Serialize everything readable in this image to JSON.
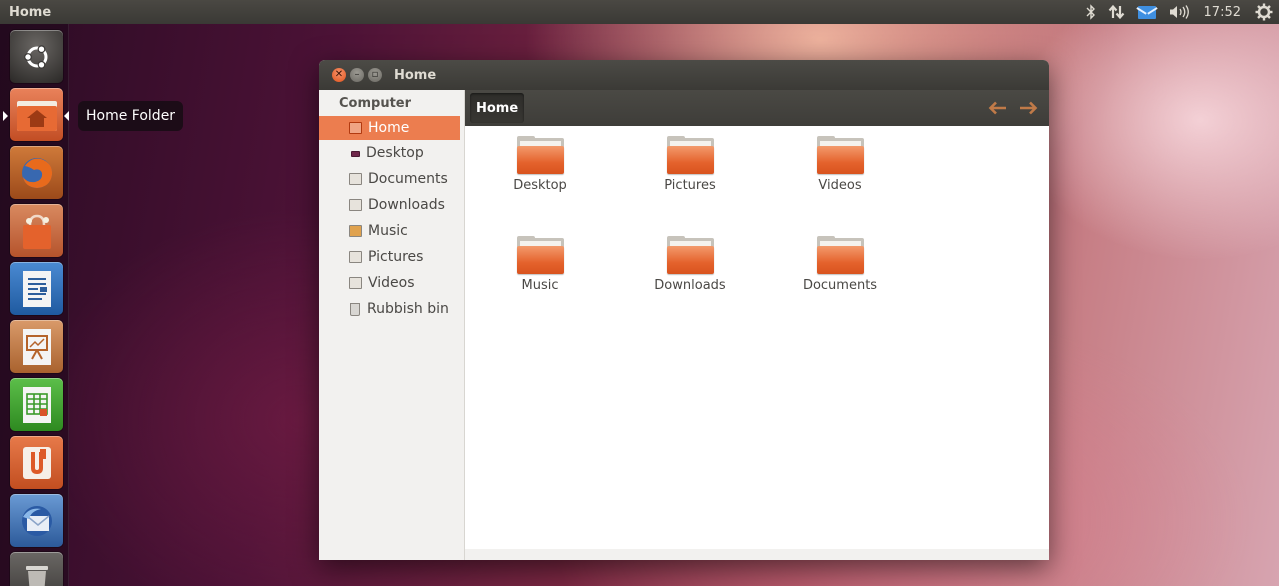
{
  "panel": {
    "app_title": "Home",
    "clock": "17:52",
    "icons": [
      "bluetooth-icon",
      "network-icon",
      "mail-icon",
      "volume-icon",
      "settings-icon"
    ]
  },
  "launcher": {
    "items": [
      {
        "name": "ubuntu-dash-icon",
        "label": "Dash"
      },
      {
        "name": "home-folder-icon",
        "label": "Home Folder"
      },
      {
        "name": "firefox-icon",
        "label": "Firefox"
      },
      {
        "name": "software-centre-icon",
        "label": "Software Centre"
      },
      {
        "name": "writer-icon",
        "label": "Writer"
      },
      {
        "name": "impress-icon",
        "label": "Impress"
      },
      {
        "name": "calc-icon",
        "label": "Calc"
      },
      {
        "name": "ubuntu-one-icon",
        "label": "Ubuntu One"
      },
      {
        "name": "thunderbird-icon",
        "label": "Thunderbird"
      },
      {
        "name": "trash-icon",
        "label": "Trash"
      }
    ],
    "tooltip": "Home Folder"
  },
  "window": {
    "title": "Home",
    "sidebar": {
      "header": "Computer",
      "items": [
        {
          "label": "Home",
          "icon": "home-icon",
          "active": true
        },
        {
          "label": "Desktop",
          "icon": "desktop-icon"
        },
        {
          "label": "Documents",
          "icon": "documents-icon"
        },
        {
          "label": "Downloads",
          "icon": "downloads-icon"
        },
        {
          "label": "Music",
          "icon": "music-icon"
        },
        {
          "label": "Pictures",
          "icon": "pictures-icon"
        },
        {
          "label": "Videos",
          "icon": "videos-icon"
        },
        {
          "label": "Rubbish bin",
          "icon": "trash-icon"
        }
      ]
    },
    "pathbar": {
      "crumb": "Home",
      "back_icon": "back-arrow-icon",
      "forward_icon": "forward-arrow-icon"
    },
    "files": [
      {
        "name": "Desktop"
      },
      {
        "name": "Pictures"
      },
      {
        "name": "Videos"
      },
      {
        "name": "Music"
      },
      {
        "name": "Downloads"
      },
      {
        "name": "Documents"
      }
    ]
  },
  "colors": {
    "accent": "#ec7d4f",
    "panel": "#3c3b37",
    "folder": "#e4622c"
  }
}
